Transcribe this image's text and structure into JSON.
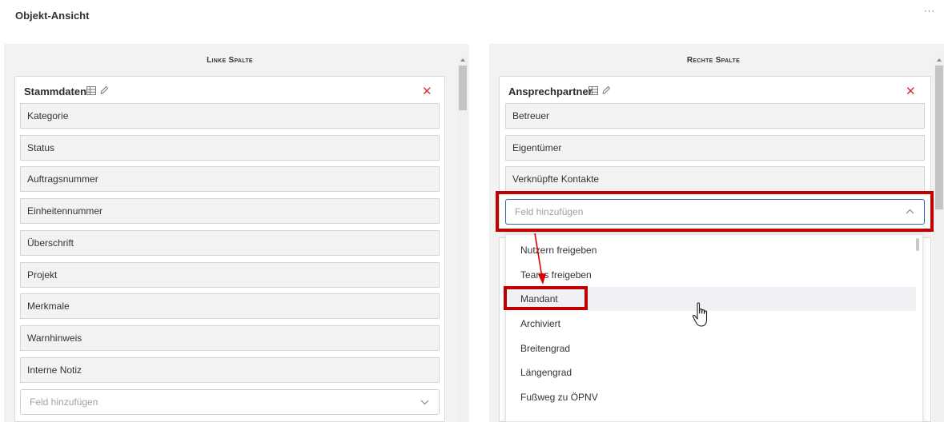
{
  "header": {
    "title": "Objekt-Ansicht",
    "more_label": "···"
  },
  "left_column": {
    "title": "Linke Spalte",
    "card": {
      "title": "Stammdaten",
      "fields": [
        "Kategorie",
        "Status",
        "Auftragsnummer",
        "Einheitennummer",
        "Überschrift",
        "Projekt",
        "Merkmale",
        "Warnhinweis",
        "Interne Notiz"
      ],
      "add_placeholder": "Feld hinzufügen"
    }
  },
  "right_column": {
    "title": "Rechte Spalte",
    "card": {
      "title": "Ansprechpartner",
      "fields": [
        "Betreuer",
        "Eigentümer",
        "Verknüpfte Kontakte"
      ],
      "add_placeholder": "Feld hinzufügen"
    }
  },
  "dropdown": {
    "options": [
      "Nutzern freigeben",
      "Teams freigeben",
      "Mandant",
      "Archiviert",
      "Breitengrad",
      "Längengrad",
      "Fußweg zu ÖPNV"
    ],
    "hovered": "Mandant"
  },
  "icons": {
    "table": "table-icon",
    "edit": "pencil-icon",
    "close": "close-icon",
    "chevron_down": "chevron-down-icon",
    "chevron_up": "chevron-up-icon",
    "cursor": "hand-cursor-icon"
  },
  "colors": {
    "highlight": "#c00000",
    "close": "#d13438",
    "focus_border": "#2b6cb0"
  }
}
